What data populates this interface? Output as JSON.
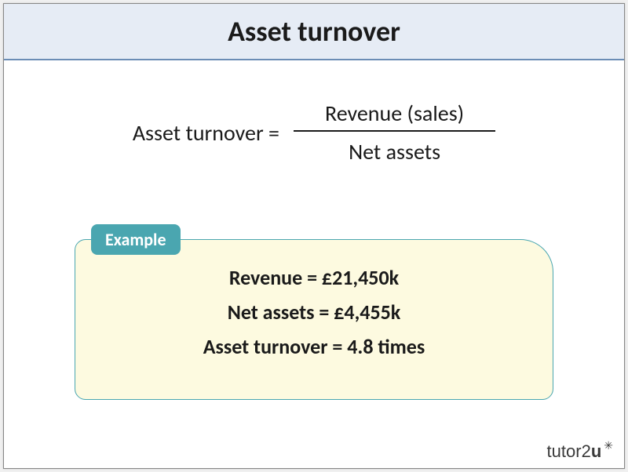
{
  "title": "Asset turnover",
  "formula": {
    "lhs": "Asset turnover =",
    "numerator": "Revenue (sales)",
    "denominator": "Net assets"
  },
  "example": {
    "tab_label": "Example",
    "lines": {
      "revenue": "Revenue = £21,450k",
      "net_assets": "Net assets = £4,455k",
      "result": "Asset turnover = 4.8 times"
    }
  },
  "branding": {
    "name_part1": "tutor2",
    "name_part2": "u",
    "accent": "✳"
  }
}
